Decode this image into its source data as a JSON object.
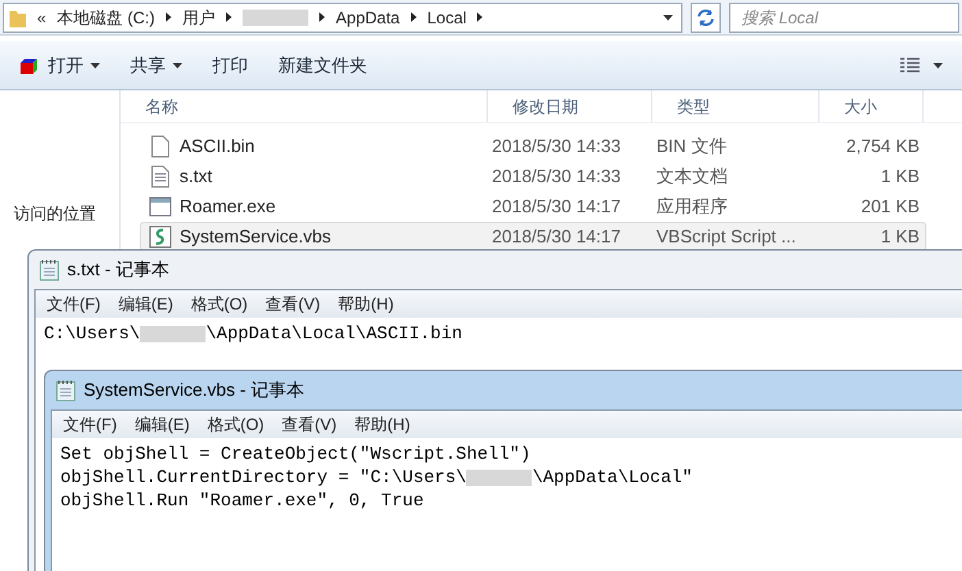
{
  "explorer": {
    "overflow": "«",
    "breadcrumb": [
      "本地磁盘 (C:)",
      "用户",
      "AppData",
      "Local"
    ],
    "search": {
      "placeholder": "搜索 Local"
    },
    "toolbar": [
      "打开",
      "共享",
      "打印",
      "新建文件夹"
    ],
    "sidebar": [
      "访问的位置"
    ],
    "columns": [
      "名称",
      "修改日期",
      "类型",
      "大小"
    ],
    "rows": [
      {
        "name": "ASCII.bin",
        "date": "2018/5/30 14:33",
        "type": "BIN 文件",
        "size": "2,754 KB",
        "kind": "blank",
        "selected": false
      },
      {
        "name": "s.txt",
        "date": "2018/5/30 14:33",
        "type": "文本文档",
        "size": "1 KB",
        "kind": "text",
        "selected": false
      },
      {
        "name": "Roamer.exe",
        "date": "2018/5/30 14:17",
        "type": "应用程序",
        "size": "201 KB",
        "kind": "app",
        "selected": false
      },
      {
        "name": "SystemService.vbs",
        "date": "2018/5/30 14:17",
        "type": "VBScript Script ...",
        "size": "1 KB",
        "kind": "script",
        "selected": true
      }
    ]
  },
  "notepads": [
    {
      "title": "s.txt - 记事本",
      "active": false,
      "menu": [
        "文件(F)",
        "编辑(E)",
        "格式(O)",
        "查看(V)",
        "帮助(H)"
      ],
      "lines": [
        [
          "C:\\Users\\",
          "\\AppData\\Local\\ASCII.bin"
        ]
      ]
    },
    {
      "title": "SystemService.vbs - 记事本",
      "active": true,
      "menu": [
        "文件(F)",
        "编辑(E)",
        "格式(O)",
        "查看(V)",
        "帮助(H)"
      ],
      "lines": [
        [
          "Set objShell = CreateObject(\"Wscript.Shell\")"
        ],
        [
          "objShell.CurrentDirectory = \"C:\\Users\\",
          "\\AppData\\Local\""
        ],
        [
          "objShell.Run \"Roamer.exe\", 0, True"
        ]
      ]
    }
  ]
}
